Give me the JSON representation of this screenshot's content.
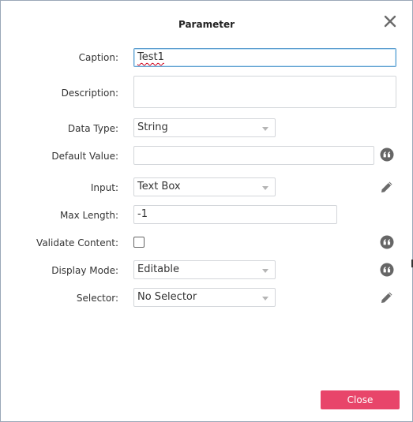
{
  "dialog": {
    "title": "Parameter",
    "close_icon": "close-icon",
    "close_button_label": "Close"
  },
  "fields": {
    "caption": {
      "label": "Caption:",
      "value": "Test1"
    },
    "description": {
      "label": "Description:",
      "value": ""
    },
    "data_type": {
      "label": "Data Type:",
      "value": "String"
    },
    "default_value": {
      "label": "Default Value:",
      "value": "",
      "icon": "quote-icon"
    },
    "input": {
      "label": "Input:",
      "value": "Text Box",
      "icon": "pencil-icon"
    },
    "max_length": {
      "label": "Max Length:",
      "value": "-1"
    },
    "validate_content": {
      "label": "Validate Content:",
      "checked": false,
      "icon": "quote-icon"
    },
    "display_mode": {
      "label": "Display Mode:",
      "value": "Editable",
      "icon": "quote-icon"
    },
    "selector": {
      "label": "Selector:",
      "value": "No Selector",
      "icon": "pencil-icon"
    }
  },
  "colors": {
    "accent_button": "#e8456a",
    "focus_border": "#5d9ecf",
    "icon": "#666666"
  }
}
